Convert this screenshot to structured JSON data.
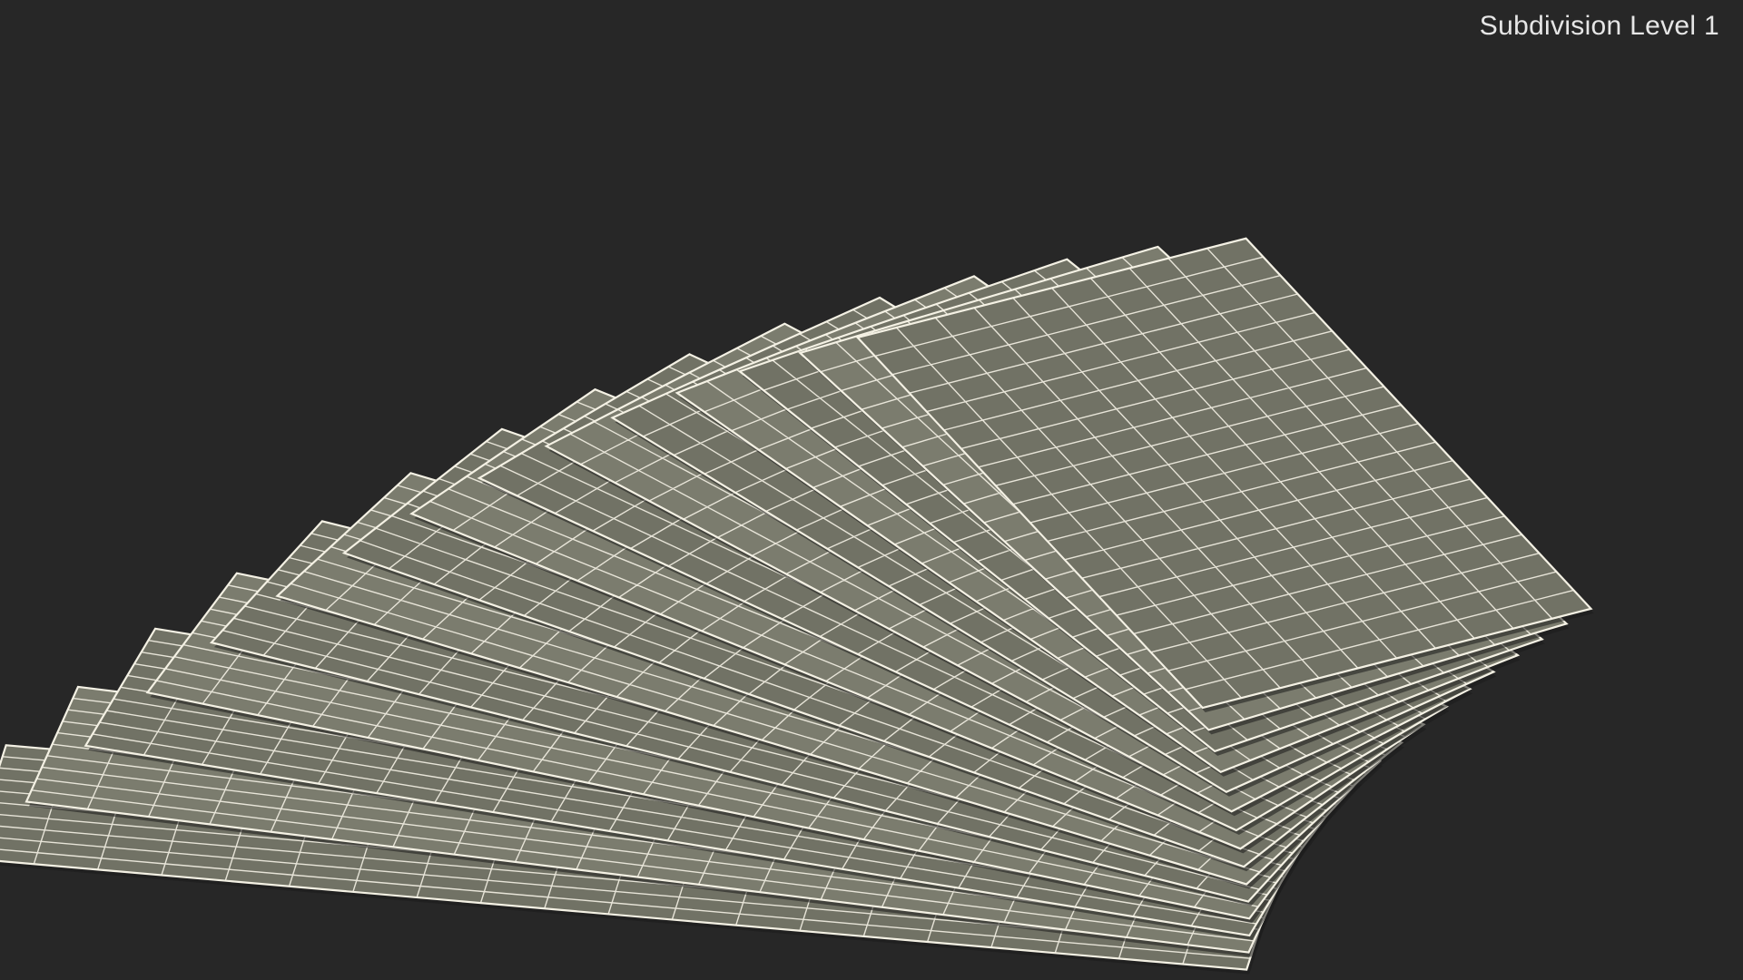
{
  "viewport": {
    "caption": "Subdivision Level 1"
  },
  "scene": {
    "subject": "fanned-sheets",
    "sheet_count": 15,
    "colors": {
      "background": "#272727",
      "sheet_fill": "#7b7c6e",
      "sheet_fill_shade": "#717265",
      "wireframe": "#f4f1e4",
      "edge_shadow": "#1c1c1c"
    }
  }
}
